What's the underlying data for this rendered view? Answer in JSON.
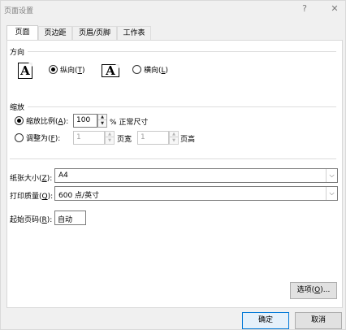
{
  "window": {
    "title": "页面设置",
    "help_icon": "?",
    "close_icon": "✕"
  },
  "tabs": [
    {
      "label": "页面",
      "active": true
    },
    {
      "label": "页边距",
      "active": false
    },
    {
      "label": "页眉/页脚",
      "active": false
    },
    {
      "label": "工作表",
      "active": false
    }
  ],
  "orientation": {
    "section_label": "方向",
    "portrait_label": "纵向(",
    "portrait_key": "T",
    "landscape_label": "横向(",
    "landscape_key": "L",
    "close_paren": ")",
    "icon_letter": "A",
    "selected": "portrait"
  },
  "scaling": {
    "section_label": "缩放",
    "adjust_label": "缩放比例(",
    "adjust_key": "A",
    "adjust_suffix": "):",
    "adjust_value": "100",
    "adjust_unit": "% 正常尺寸",
    "fit_label": "调整为(",
    "fit_key": "F",
    "fit_suffix": "):",
    "fit_wide_value": "1",
    "fit_wide_unit": "页宽",
    "fit_tall_value": "1",
    "fit_tall_unit": "页高",
    "selected": "adjust"
  },
  "paper": {
    "size_label": "纸张大小(",
    "size_key": "Z",
    "size_suffix": "):",
    "size_value": "A4",
    "quality_label": "打印质量(",
    "quality_key": "Q",
    "quality_suffix": "):",
    "quality_value": "600 点/英寸",
    "first_page_label": "起始页码(",
    "first_page_key": "R",
    "first_page_suffix": "):",
    "first_page_value": "自动"
  },
  "buttons": {
    "options_label": "选项(",
    "options_key": "O",
    "options_suffix": ")...",
    "ok_label": "确定",
    "cancel_label": "取消"
  },
  "colors": {
    "accent": "#0078d7",
    "background": "#f0f0f0",
    "panel": "#ffffff"
  }
}
